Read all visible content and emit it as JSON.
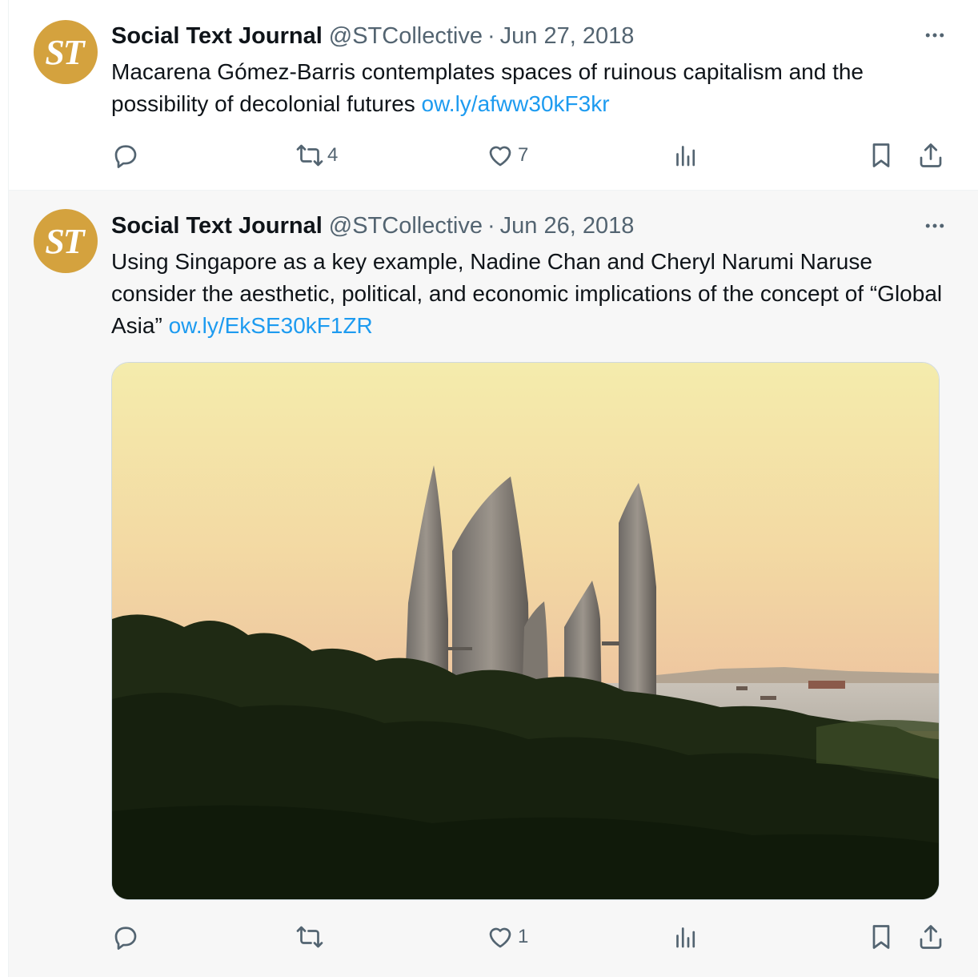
{
  "tweets": [
    {
      "avatar_text": "ST",
      "name": "Social Text Journal",
      "handle": "@STCollective",
      "separator": "·",
      "date": "Jun 27, 2018",
      "text": "Macarena Gómez-Barris contemplates spaces of ruinous capitalism and the possibility of decolonial futures ",
      "link": "ow.ly/afww30kF3kr",
      "retweets": "4",
      "likes": "7"
    },
    {
      "avatar_text": "ST",
      "name": "Social Text Journal",
      "handle": "@STCollective",
      "separator": "·",
      "date": "Jun 26, 2018",
      "text": "Using Singapore as a key example, Nadine Chan and Cheryl Narumi Naruse consider the aesthetic, political, and economic implications of the concept of “Global Asia” ",
      "link": "ow.ly/EkSE30kF1ZR",
      "retweets": "",
      "likes": "1"
    }
  ],
  "icons": {
    "reply": "reply-icon",
    "retweet": "retweet-icon",
    "like": "heart-icon",
    "views": "views-icon",
    "bookmark": "bookmark-icon",
    "share": "share-icon",
    "more": "more-icon"
  },
  "colors": {
    "link": "#1d9bf0",
    "secondary_text": "#536471",
    "avatar_bg": "#d4a23e"
  }
}
